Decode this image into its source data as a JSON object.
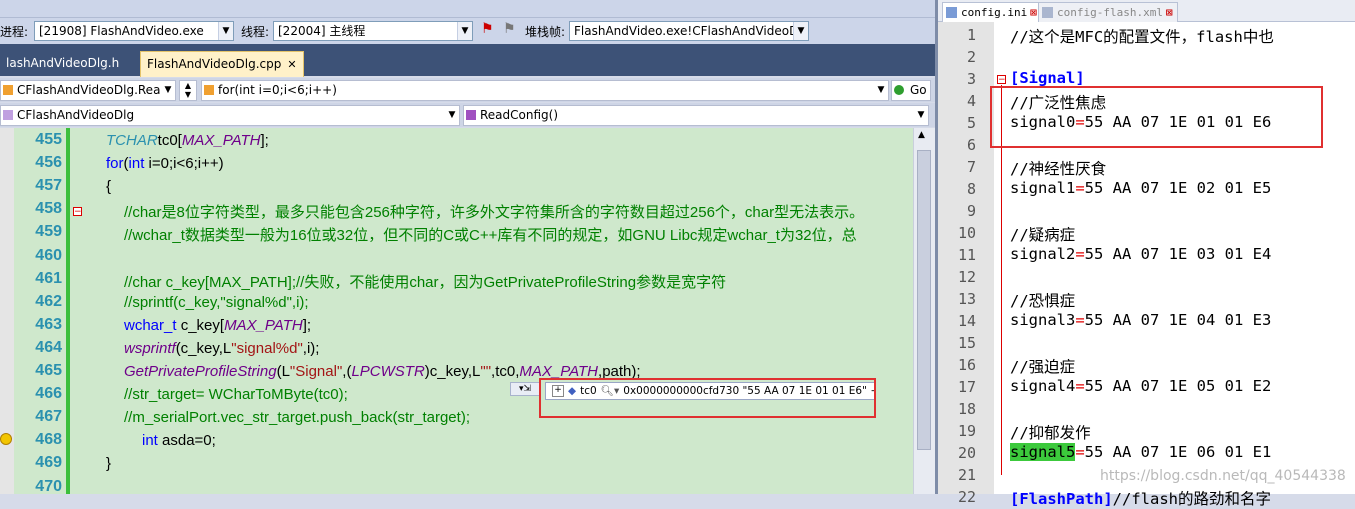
{
  "debug_bar": {
    "process_label": "进程:",
    "process_value": "[21908] FlashAndVideo.exe",
    "thread_label": "线程:",
    "thread_value": "[22004] 主线程",
    "stack_label": "堆栈帧:",
    "stack_value": "FlashAndVideo.exe!CFlashAndVideoDl"
  },
  "tabs": [
    {
      "label": "lashAndVideoDlg.h",
      "active": false
    },
    {
      "label": "FlashAndVideoDlg.cpp",
      "active": true
    }
  ],
  "nav": {
    "file_combo": "CFlashAndVideoDlg.Reac",
    "scope_combo": "for(int i=0;i<6;i++)",
    "go_label": "Go",
    "class_combo": "CFlashAndVideoDlg",
    "method_combo": "ReadConfig()"
  },
  "code_lines": [
    {
      "n": "455",
      "indent": 1,
      "tokens": [
        [
          "ty",
          "TCHAR"
        ],
        [
          "",
          "tc0["
        ],
        [
          "mac",
          "MAX_PATH"
        ],
        [
          "",
          "];"
        ]
      ]
    },
    {
      "n": "456",
      "indent": 1,
      "tokens": [
        [
          "kw",
          "for"
        ],
        [
          "",
          "("
        ],
        [
          "kw",
          "int"
        ],
        [
          "",
          " i=0;i<6;i++)"
        ]
      ]
    },
    {
      "n": "457",
      "indent": 1,
      "tokens": [
        [
          "",
          "{"
        ]
      ]
    },
    {
      "n": "458",
      "indent": 2,
      "tokens": [
        [
          "cm",
          "//char是8位字符类型，最多只能包含256种字符，许多外文字符集所含的字符数目超过256个，char型无法表示。"
        ]
      ]
    },
    {
      "n": "459",
      "indent": 2,
      "tokens": [
        [
          "cm",
          "//wchar_t数据类型一般为16位或32位，但不同的C或C++库有不同的规定，如GNU Libc规定wchar_t为32位，总"
        ]
      ]
    },
    {
      "n": "460",
      "indent": 2,
      "tokens": []
    },
    {
      "n": "461",
      "indent": 2,
      "tokens": [
        [
          "cm",
          "//char c_key[MAX_PATH];//失败，不能使用char，因为GetPrivateProfileString参数是宽字符"
        ]
      ]
    },
    {
      "n": "462",
      "indent": 2,
      "tokens": [
        [
          "cm",
          "//sprintf(c_key,\"signal%d\",i);"
        ]
      ]
    },
    {
      "n": "463",
      "indent": 2,
      "tokens": [
        [
          "ty2",
          "wchar_t"
        ],
        [
          "",
          " c_key["
        ],
        [
          "mac",
          "MAX_PATH"
        ],
        [
          "",
          "];"
        ]
      ]
    },
    {
      "n": "464",
      "indent": 2,
      "tokens": [
        [
          "mac",
          "wsprintf"
        ],
        [
          "",
          "(c_key,L"
        ],
        [
          "str",
          "\"signal%d\""
        ],
        [
          "",
          ",i);"
        ]
      ]
    },
    {
      "n": "465",
      "indent": 2,
      "tokens": [
        [
          "mac",
          "GetPrivateProfileString"
        ],
        [
          "",
          "(L"
        ],
        [
          "str",
          "\"Signal\""
        ],
        [
          "",
          ",("
        ],
        [
          "mac",
          "LPCWSTR"
        ],
        [
          "",
          ")c_key,L"
        ],
        [
          "str",
          "\"\""
        ],
        [
          "",
          ",tc0,"
        ],
        [
          "mac",
          "MAX_PATH"
        ],
        [
          "",
          ",path);"
        ]
      ]
    },
    {
      "n": "466",
      "indent": 2,
      "tokens": [
        [
          "cm",
          "//str_target= WCharToMByte(tc0);"
        ]
      ]
    },
    {
      "n": "467",
      "indent": 2,
      "tokens": [
        [
          "cm",
          "//m_serialPort.vec_str_target.push_back(str_target);"
        ]
      ]
    },
    {
      "n": "468",
      "indent": 3,
      "tokens": [
        [
          "kw",
          "int"
        ],
        [
          "",
          " asda=0;"
        ]
      ]
    },
    {
      "n": "469",
      "indent": 1,
      "tokens": [
        [
          "",
          "}"
        ]
      ]
    },
    {
      "n": "470",
      "indent": 1,
      "tokens": []
    }
  ],
  "datatip": {
    "name": "tc0",
    "value": "0x0000000000cfd730 \"55 AA 07 1E 01 01 E6\""
  },
  "right_tabs": [
    {
      "label": "config.ini",
      "active": true
    },
    {
      "label": "config-flash.xml",
      "active": false
    }
  ],
  "ini_lines": [
    {
      "n": "1",
      "parts": [
        [
          "rcm",
          "//这个是MFC的配置文件，flash中也"
        ]
      ]
    },
    {
      "n": "2",
      "parts": []
    },
    {
      "n": "3",
      "parts": [
        [
          "sec",
          "[Signal]"
        ]
      ]
    },
    {
      "n": "4",
      "parts": [
        [
          "rcm",
          "//广泛性焦虑"
        ]
      ]
    },
    {
      "n": "5",
      "parts": [
        [
          "",
          "signal0"
        ],
        [
          "red",
          "="
        ],
        [
          "",
          "55 AA 07 1E 01 01 E6"
        ]
      ]
    },
    {
      "n": "6",
      "parts": []
    },
    {
      "n": "7",
      "parts": [
        [
          "rcm",
          "//神经性厌食"
        ]
      ]
    },
    {
      "n": "8",
      "parts": [
        [
          "",
          "signal1"
        ],
        [
          "red",
          "="
        ],
        [
          "",
          "55 AA 07 1E 02 01 E5"
        ]
      ]
    },
    {
      "n": "9",
      "parts": []
    },
    {
      "n": "10",
      "parts": [
        [
          "rcm",
          "//疑病症"
        ]
      ]
    },
    {
      "n": "11",
      "parts": [
        [
          "",
          "signal2"
        ],
        [
          "red",
          "="
        ],
        [
          "",
          "55 AA 07 1E 03 01 E4"
        ]
      ]
    },
    {
      "n": "12",
      "parts": []
    },
    {
      "n": "13",
      "parts": [
        [
          "rcm",
          "//恐惧症"
        ]
      ]
    },
    {
      "n": "14",
      "parts": [
        [
          "",
          "signal3"
        ],
        [
          "red",
          "="
        ],
        [
          "",
          "55 AA 07 1E 04 01 E3"
        ]
      ]
    },
    {
      "n": "15",
      "parts": []
    },
    {
      "n": "16",
      "parts": [
        [
          "rcm",
          "//强迫症"
        ]
      ]
    },
    {
      "n": "17",
      "parts": [
        [
          "",
          "signal4"
        ],
        [
          "red",
          "="
        ],
        [
          "",
          "55 AA 07 1E 05 01 E2"
        ]
      ]
    },
    {
      "n": "18",
      "parts": []
    },
    {
      "n": "19",
      "parts": [
        [
          "rcm",
          "//抑郁发作"
        ]
      ]
    },
    {
      "n": "20",
      "parts": [
        [
          "hl",
          "signal5"
        ],
        [
          "red",
          "="
        ],
        [
          "",
          "55 AA 07 1E 06 01 E1"
        ]
      ]
    },
    {
      "n": "21",
      "parts": []
    },
    {
      "n": "22",
      "parts": [
        [
          "sec",
          "[FlashPath]"
        ],
        [
          "rcm",
          "//flash的路劲和名字"
        ]
      ]
    }
  ],
  "watermark": "https://blog.csdn.net/qq_40544338",
  "colors": {
    "accent_red": "#e03030",
    "selection_green": "#3cc93c",
    "editor_bg": "#cfe8cc"
  }
}
